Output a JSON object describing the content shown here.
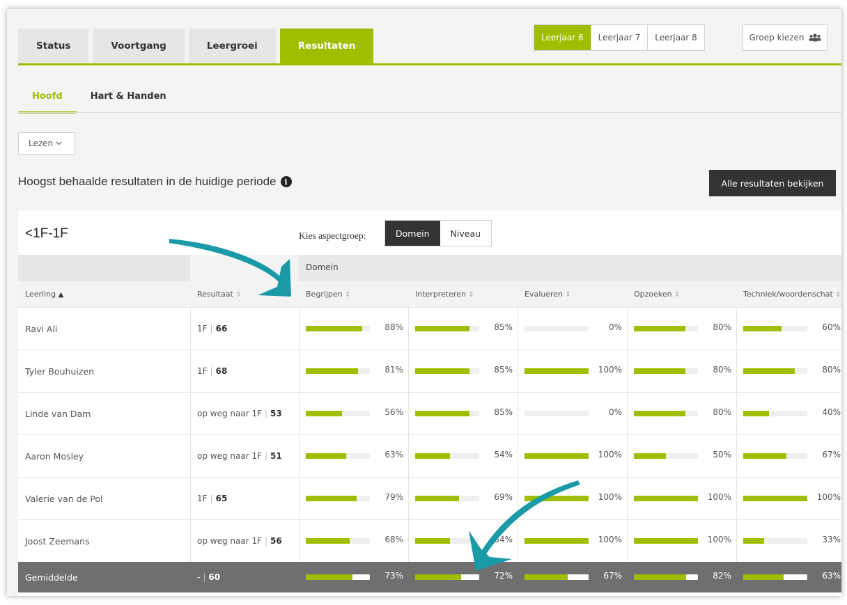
{
  "tabs": [
    "Status",
    "Voortgang",
    "Leergroei",
    "Resultaten"
  ],
  "active_tab": "Resultaten",
  "years": [
    "Leerjaar 6",
    "Leerjaar 7",
    "Leerjaar 8"
  ],
  "active_year": "Leerjaar 6",
  "group_button": "Groep kiezen",
  "subtabs": [
    "Hoofd",
    "Hart & Handen"
  ],
  "dropdown": "Lezen",
  "heading": "Hoogst behaalde resultaten in de huidige periode",
  "all_results_button": "Alle resultaten bekijken",
  "panel": {
    "title": "<1F-1F",
    "aspect_label": "Kies aspectgroep:",
    "aspect_options": [
      "Domein",
      "Niveau"
    ],
    "active_aspect": "Domein",
    "group_header": "Domein",
    "columns": [
      "Leerling",
      "Resultaat",
      "Begrijpen",
      "Interpreteren",
      "Evalueren",
      "Opzoeken",
      "Techniek/woordenschat"
    ],
    "rows": [
      {
        "name": "Ravi Ali",
        "level": "1F",
        "score": "66",
        "pcts": [
          88,
          85,
          0,
          80,
          60
        ]
      },
      {
        "name": "Tyler Bouhuizen",
        "level": "1F",
        "score": "68",
        "pcts": [
          81,
          85,
          100,
          80,
          80
        ]
      },
      {
        "name": "Linde van Dam",
        "level": "op weg naar 1F",
        "score": "53",
        "pcts": [
          56,
          85,
          0,
          80,
          40
        ]
      },
      {
        "name": "Aaron Mosley",
        "level": "op weg naar 1F",
        "score": "51",
        "pcts": [
          63,
          54,
          100,
          50,
          67
        ]
      },
      {
        "name": "Valerie van de Pol",
        "level": "1F",
        "score": "65",
        "pcts": [
          79,
          69,
          100,
          100,
          100
        ]
      },
      {
        "name": "Joost Zeemans",
        "level": "op weg naar 1F",
        "score": "56",
        "pcts": [
          68,
          54,
          100,
          100,
          33
        ]
      }
    ],
    "average": {
      "name": "Gemiddelde",
      "level": "-",
      "score": "60",
      "pcts": [
        73,
        72,
        67,
        82,
        63
      ]
    }
  },
  "colors": {
    "accent": "#9dbf00",
    "dark": "#333333",
    "arrow": "#1a9aa6"
  }
}
